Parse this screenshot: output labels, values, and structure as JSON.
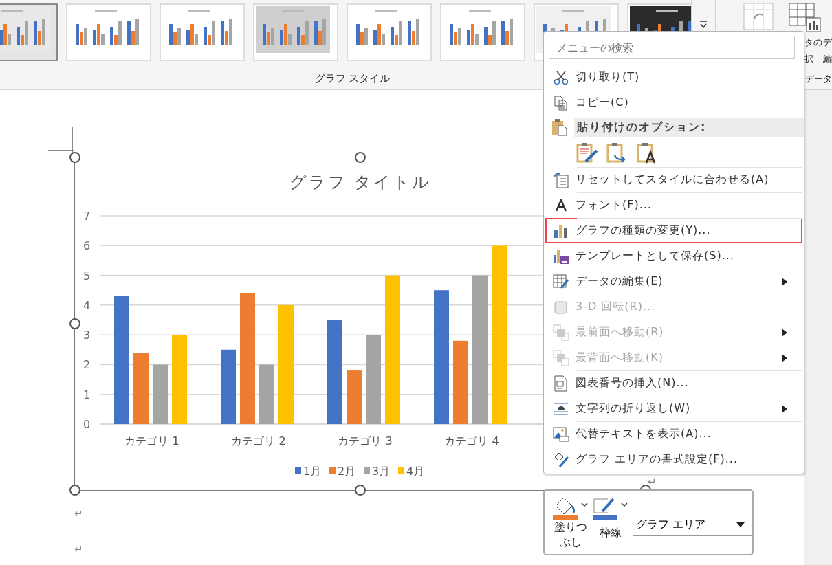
{
  "ribbon": {
    "gallery": [
      {
        "selected": true
      },
      {
        "selected": false
      },
      {
        "selected": false
      },
      {
        "selected": false
      },
      {
        "selected": false
      },
      {
        "selected": false
      },
      {
        "selected": false
      },
      {
        "selected": false
      }
    ],
    "gallery_label": "グラフ スタイル",
    "right_labels": [
      {
        "top": "タの",
        "bottom": "択"
      },
      {
        "top": "デ",
        "bottom": "編"
      }
    ],
    "group_label": "データ"
  },
  "document": {
    "chart": {
      "chart_data": {
        "type": "bar",
        "title": "グラフ タイトル",
        "categories": [
          "カテゴリ 1",
          "カテゴリ 2",
          "カテゴリ 3",
          "カテゴリ 4"
        ],
        "ylim": [
          0,
          7
        ],
        "grid": true,
        "legend": "bottom",
        "yticks": [
          0,
          1,
          2,
          3,
          4,
          5,
          6,
          7
        ],
        "series": [
          {
            "name": "1月",
            "color": "#4472c4",
            "values": [
              4.3,
              2.5,
              3.5,
              4.5
            ]
          },
          {
            "name": "2月",
            "color": "#ed7d31",
            "values": [
              2.4,
              4.4,
              1.8,
              2.8
            ]
          },
          {
            "name": "3月",
            "color": "#a5a5a5",
            "values": [
              2,
              2,
              3,
              5
            ]
          },
          {
            "name": "4月",
            "color": "#ffc000",
            "values": [
              3,
              4,
              5,
              6
            ]
          }
        ]
      }
    },
    "chart_end_mark": "↵",
    "paragraph_marks": [
      "↵",
      "↵"
    ]
  },
  "context_menu": {
    "search": {
      "placeholder": "メニューの検索"
    },
    "items": [
      {
        "kind": "item",
        "label": "切り取り(T)",
        "disabled": false,
        "submenu": false,
        "highlighted": false,
        "separator_before": false
      },
      {
        "kind": "item",
        "label": "コピー(C)",
        "disabled": false,
        "submenu": false,
        "highlighted": false,
        "separator_before": false
      },
      {
        "kind": "header",
        "label": "貼り付けのオプション:"
      },
      {
        "kind": "paste_options"
      },
      {
        "kind": "item",
        "label": "リセットしてスタイルに合わせる(A)",
        "disabled": false,
        "submenu": false,
        "highlighted": false,
        "separator_before": true
      },
      {
        "kind": "item",
        "label": "フォント(F)...",
        "disabled": false,
        "submenu": false,
        "highlighted": false,
        "separator_before": true
      },
      {
        "kind": "item",
        "label": "グラフの種類の変更(Y)...",
        "disabled": false,
        "submenu": false,
        "highlighted": true,
        "separator_before": true
      },
      {
        "kind": "item",
        "label": "テンプレートとして保存(S)...",
        "disabled": false,
        "submenu": false,
        "highlighted": false,
        "separator_before": false
      },
      {
        "kind": "item",
        "label": "データの編集(E)",
        "disabled": false,
        "submenu": true,
        "highlighted": false,
        "separator_before": false
      },
      {
        "kind": "item",
        "label": "3-D 回転(R)...",
        "disabled": true,
        "submenu": false,
        "highlighted": false,
        "separator_before": false
      },
      {
        "kind": "item",
        "label": "最前面へ移動(R)",
        "disabled": true,
        "submenu": true,
        "highlighted": false,
        "separator_before": true
      },
      {
        "kind": "item",
        "label": "最背面へ移動(K)",
        "disabled": true,
        "submenu": true,
        "highlighted": false,
        "separator_before": false
      },
      {
        "kind": "item",
        "label": "図表番号の挿入(N)...",
        "disabled": false,
        "submenu": false,
        "highlighted": false,
        "separator_before": true
      },
      {
        "kind": "item",
        "label": "文字列の折り返し(W)",
        "disabled": false,
        "submenu": true,
        "highlighted": false,
        "separator_before": false
      },
      {
        "kind": "item",
        "label": "代替テキストを表示(A)...",
        "disabled": false,
        "submenu": false,
        "highlighted": false,
        "separator_before": true
      },
      {
        "kind": "item",
        "label": "グラフ エリアの書式設定(F)...",
        "disabled": false,
        "submenu": false,
        "highlighted": false,
        "separator_before": false
      }
    ]
  },
  "mini_toolbar": {
    "fill_label": "塗りつぶし",
    "outline_label": "枠線",
    "element_select": {
      "value": "グラフ エリア"
    }
  }
}
